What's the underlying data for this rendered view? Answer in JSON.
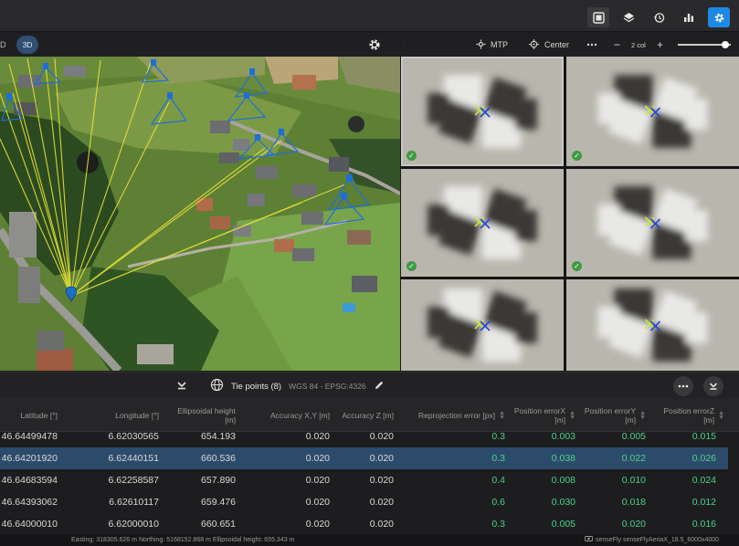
{
  "view_toolbar": {
    "mode_2d": "D",
    "mode_3d": "3D"
  },
  "image_toolbar": {
    "mtp_label": "MTP",
    "center_label": "Center",
    "zoom_label": "2 col",
    "minus": "−",
    "plus": "+"
  },
  "panel": {
    "title": "Tie points (8)",
    "crs": "WGS 84 - EPSG:4326"
  },
  "table": {
    "columns": [
      "Latitude [°]",
      "Longitude [°]",
      "Ellipsoidal height [m]",
      "Accuracy X,Y [m]",
      "Accuracy Z [m]",
      "Reprojection error [px]",
      "Position errorX [m]",
      "Position errorY [m]",
      "Position errorZ [m]"
    ],
    "rows": [
      {
        "lat": "46.64499478",
        "lon": "6.62030565",
        "h": "654.193",
        "axy": "0.020",
        "az": "0.020",
        "rep": "0.3",
        "ex": "0.003",
        "ey": "0.005",
        "ez": "0.015"
      },
      {
        "lat": "46.64201920",
        "lon": "6.62440151",
        "h": "660.536",
        "axy": "0.020",
        "az": "0.020",
        "rep": "0.3",
        "ex": "0.038",
        "ey": "0.022",
        "ez": "0.026"
      },
      {
        "lat": "46.64683594",
        "lon": "6.62258587",
        "h": "657.890",
        "axy": "0.020",
        "az": "0.020",
        "rep": "0.4",
        "ex": "0.008",
        "ey": "0.010",
        "ez": "0.024"
      },
      {
        "lat": "46.64393062",
        "lon": "6.62610117",
        "h": "659.476",
        "axy": "0.020",
        "az": "0.020",
        "rep": "0.6",
        "ex": "0.030",
        "ey": "0.018",
        "ez": "0.012"
      },
      {
        "lat": "46.64000010",
        "lon": "6.62000010",
        "h": "660.651",
        "axy": "0.020",
        "az": "0.020",
        "rep": "0.3",
        "ex": "0.005",
        "ey": "0.020",
        "ez": "0.016"
      }
    ],
    "selected_row": 1
  },
  "status": {
    "coords": "Easting: 318305.626 m   Northing: 5168152.868 m   Ellipsoidal height: 655.343 m",
    "camera": "senseFly senseFlyAeriaX_18.5_6000x4000"
  },
  "colors": {
    "accent": "#1e88e5",
    "selected_row": "#2c4b6b",
    "value_green": "#4fd08b",
    "ray_yellow": "#e8e23a",
    "camera_blue": "#1e6fd9"
  }
}
